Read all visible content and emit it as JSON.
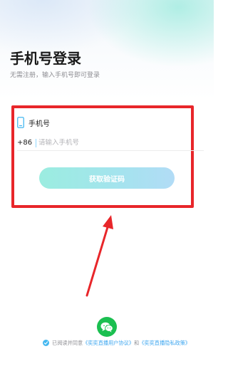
{
  "header": {
    "title": "手机号登录",
    "subtitle": "无需注册，输入手机号即可登录"
  },
  "form": {
    "phone_label": "手机号",
    "country_code": "+86",
    "phone_placeholder": "请输入手机号",
    "phone_value": "",
    "submit_label": "获取验证码"
  },
  "footer": {
    "agreement_prefix": "已阅读并同意",
    "user_agreement": "《奕奕直播用户协议》",
    "conjunction": "和",
    "privacy_policy": "《奕奕直播隐私政策》"
  },
  "colors": {
    "highlight_box": "#e8262a",
    "arrow": "#e8262a",
    "wechat_green": "#1bbf50",
    "link_blue": "#3fa7f0",
    "button_gradient_start": "#9bede0",
    "button_gradient_end": "#b2dcf6"
  },
  "icons": {
    "phone": "phone-icon",
    "wechat": "wechat-icon",
    "check": "check-icon"
  }
}
